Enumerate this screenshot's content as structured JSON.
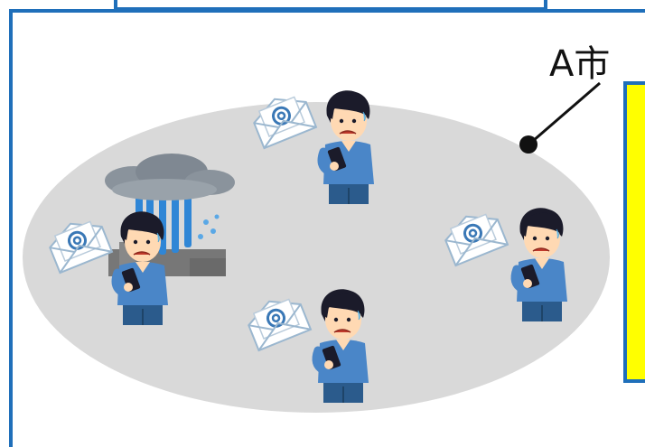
{
  "city_label": "A市",
  "colors": {
    "frame_border": "#1f6fba",
    "tab_border": "#1f6fba",
    "ellipse_fill": "#d9d9d9",
    "note_fill": "#ffff00",
    "note_border": "#1f6fba",
    "person_shirt": "#4a86c8",
    "person_pants": "#2b5b8c",
    "person_hair": "#1b1b2a",
    "skin": "#ffd9b3",
    "email_outline": "#9bb7cf",
    "cloud": "#8a939c",
    "rain": "#2f86d6",
    "buildings": "#777777"
  },
  "icons": [
    "email-envelope-icon",
    "person-with-phone-icon",
    "heavy-rain-cloud-icon",
    "pointer-dot-icon"
  ]
}
